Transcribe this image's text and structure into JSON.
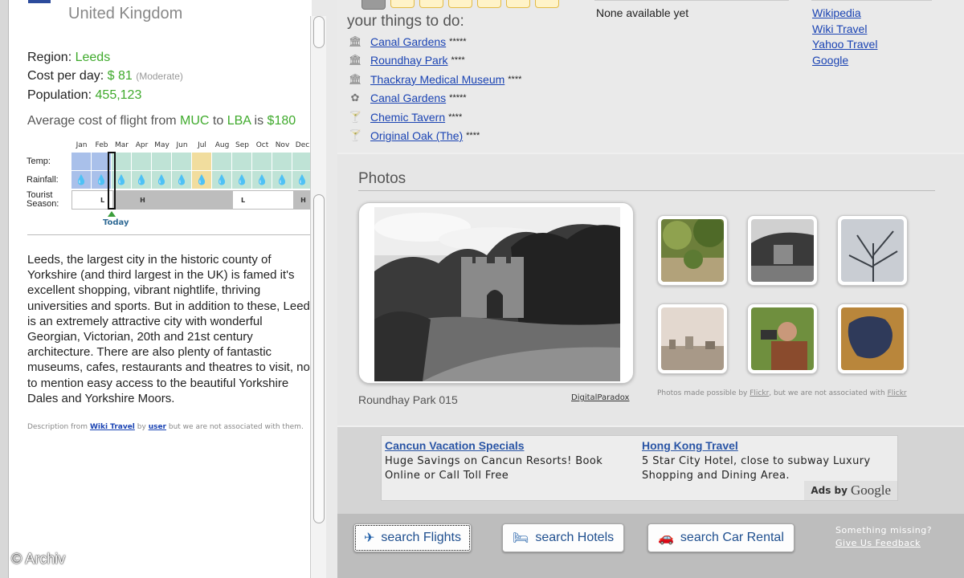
{
  "location": {
    "country": "United Kingdom",
    "region_label": "Region:",
    "region": "Leeds",
    "cost_label": "Cost per day:",
    "cost": "$ 81",
    "cost_level": "(Moderate)",
    "population_label": "Population:",
    "population": "455,123"
  },
  "flight": {
    "prefix": "Average cost of flight from",
    "from": "MUC",
    "to_word": "to",
    "to": "LBA",
    "is_word": "is",
    "cost": "$180"
  },
  "climate": {
    "months": [
      "Jan",
      "Feb",
      "Mar",
      "Apr",
      "May",
      "Jun",
      "Jul",
      "Aug",
      "Sep",
      "Oct",
      "Nov",
      "Dec"
    ],
    "temp_label": "Temp:",
    "rainfall_label": "Rainfall:",
    "season_label_1": "Tourist",
    "season_label_2": "Season:",
    "temp_colors": [
      "#a9c0ea",
      "#a9c0ea",
      "#bfe3d6",
      "#bfe3d6",
      "#bfe3d6",
      "#bfe3d6",
      "#f1dd9e",
      "#bfe3d6",
      "#bfe3d6",
      "#bfe3d6",
      "#bfe3d6",
      "#bfe3d6"
    ],
    "season_marks": [
      "",
      "L",
      "",
      "H",
      "",
      "",
      "",
      "",
      "L",
      "",
      "",
      "H"
    ],
    "season_colors": [
      "#ffffff",
      "#ffffff",
      "#bdbdbd",
      "#bdbdbd",
      "#bdbdbd",
      "#bdbdbd",
      "#bdbdbd",
      "#bdbdbd",
      "#ffffff",
      "#ffffff",
      "#ffffff",
      "#bdbdbd"
    ],
    "today_month_index": 1,
    "today_label": "Today"
  },
  "description": {
    "text": "Leeds, the largest city in the historic county of Yorkshire (and third largest in the UK) is famed it's excellent shopping, vibrant nightlife, thriving universities and sports. But in addition to these, Leeds is an extremely attractive city with wonderful Georgian, Victorian, 20th and 21st century architecture. There are also plenty of fantastic museums, cafes, restaurants and theatres to visit, not to mention easy access to the beautiful Yorkshire Dales and Yorkshire Moors.",
    "credit_prefix": "Description from",
    "credit_source": "Wiki Travel",
    "credit_by": "by",
    "credit_user": "user",
    "credit_suffix": "but we are not associated with them."
  },
  "todo": {
    "heading": "your things to do:",
    "items": [
      {
        "name": "Canal Gardens",
        "stars": "*****",
        "icon": "building-icon"
      },
      {
        "name": "Roundhay Park",
        "stars": "****",
        "icon": "building-icon"
      },
      {
        "name": "Thackray Medical Museum",
        "stars": "****",
        "icon": "building-icon"
      },
      {
        "name": "Canal Gardens",
        "stars": "*****",
        "icon": "butterfly-icon"
      },
      {
        "name": "Chemic Tavern",
        "stars": "****",
        "icon": "cocktail-icon"
      },
      {
        "name": "Original Oak (The)",
        "stars": "****",
        "icon": "cocktail-icon"
      }
    ]
  },
  "none_available": "None available yet",
  "links": [
    "Wikipedia",
    "Wiki Travel",
    "Yahoo Travel",
    "Google"
  ],
  "photos": {
    "title": "Photos",
    "caption": "Roundhay Park 015",
    "credit": "DigitalParadox",
    "note_prefix": "Photos made possible by",
    "note_link1": "Flickr",
    "note_middle": ", but we are not associated with",
    "note_link2": "Flickr"
  },
  "ads": [
    {
      "title": "Cancun Vacation Specials",
      "text": "Huge Savings on Cancun Resorts! Book Online or Call Toll Free"
    },
    {
      "title": "Hong Kong Travel",
      "text": "5 Star City Hotel, close to subway Luxury Shopping and Dining Area."
    }
  ],
  "ads_by": "Ads by",
  "ads_google": "Google",
  "search": {
    "flights": "search Flights",
    "hotels": "search Hotels",
    "car": "search Car Rental"
  },
  "feedback": {
    "line1": "Something missing?",
    "line2": "Give Us Feedback"
  },
  "watermark": "© Archiv"
}
